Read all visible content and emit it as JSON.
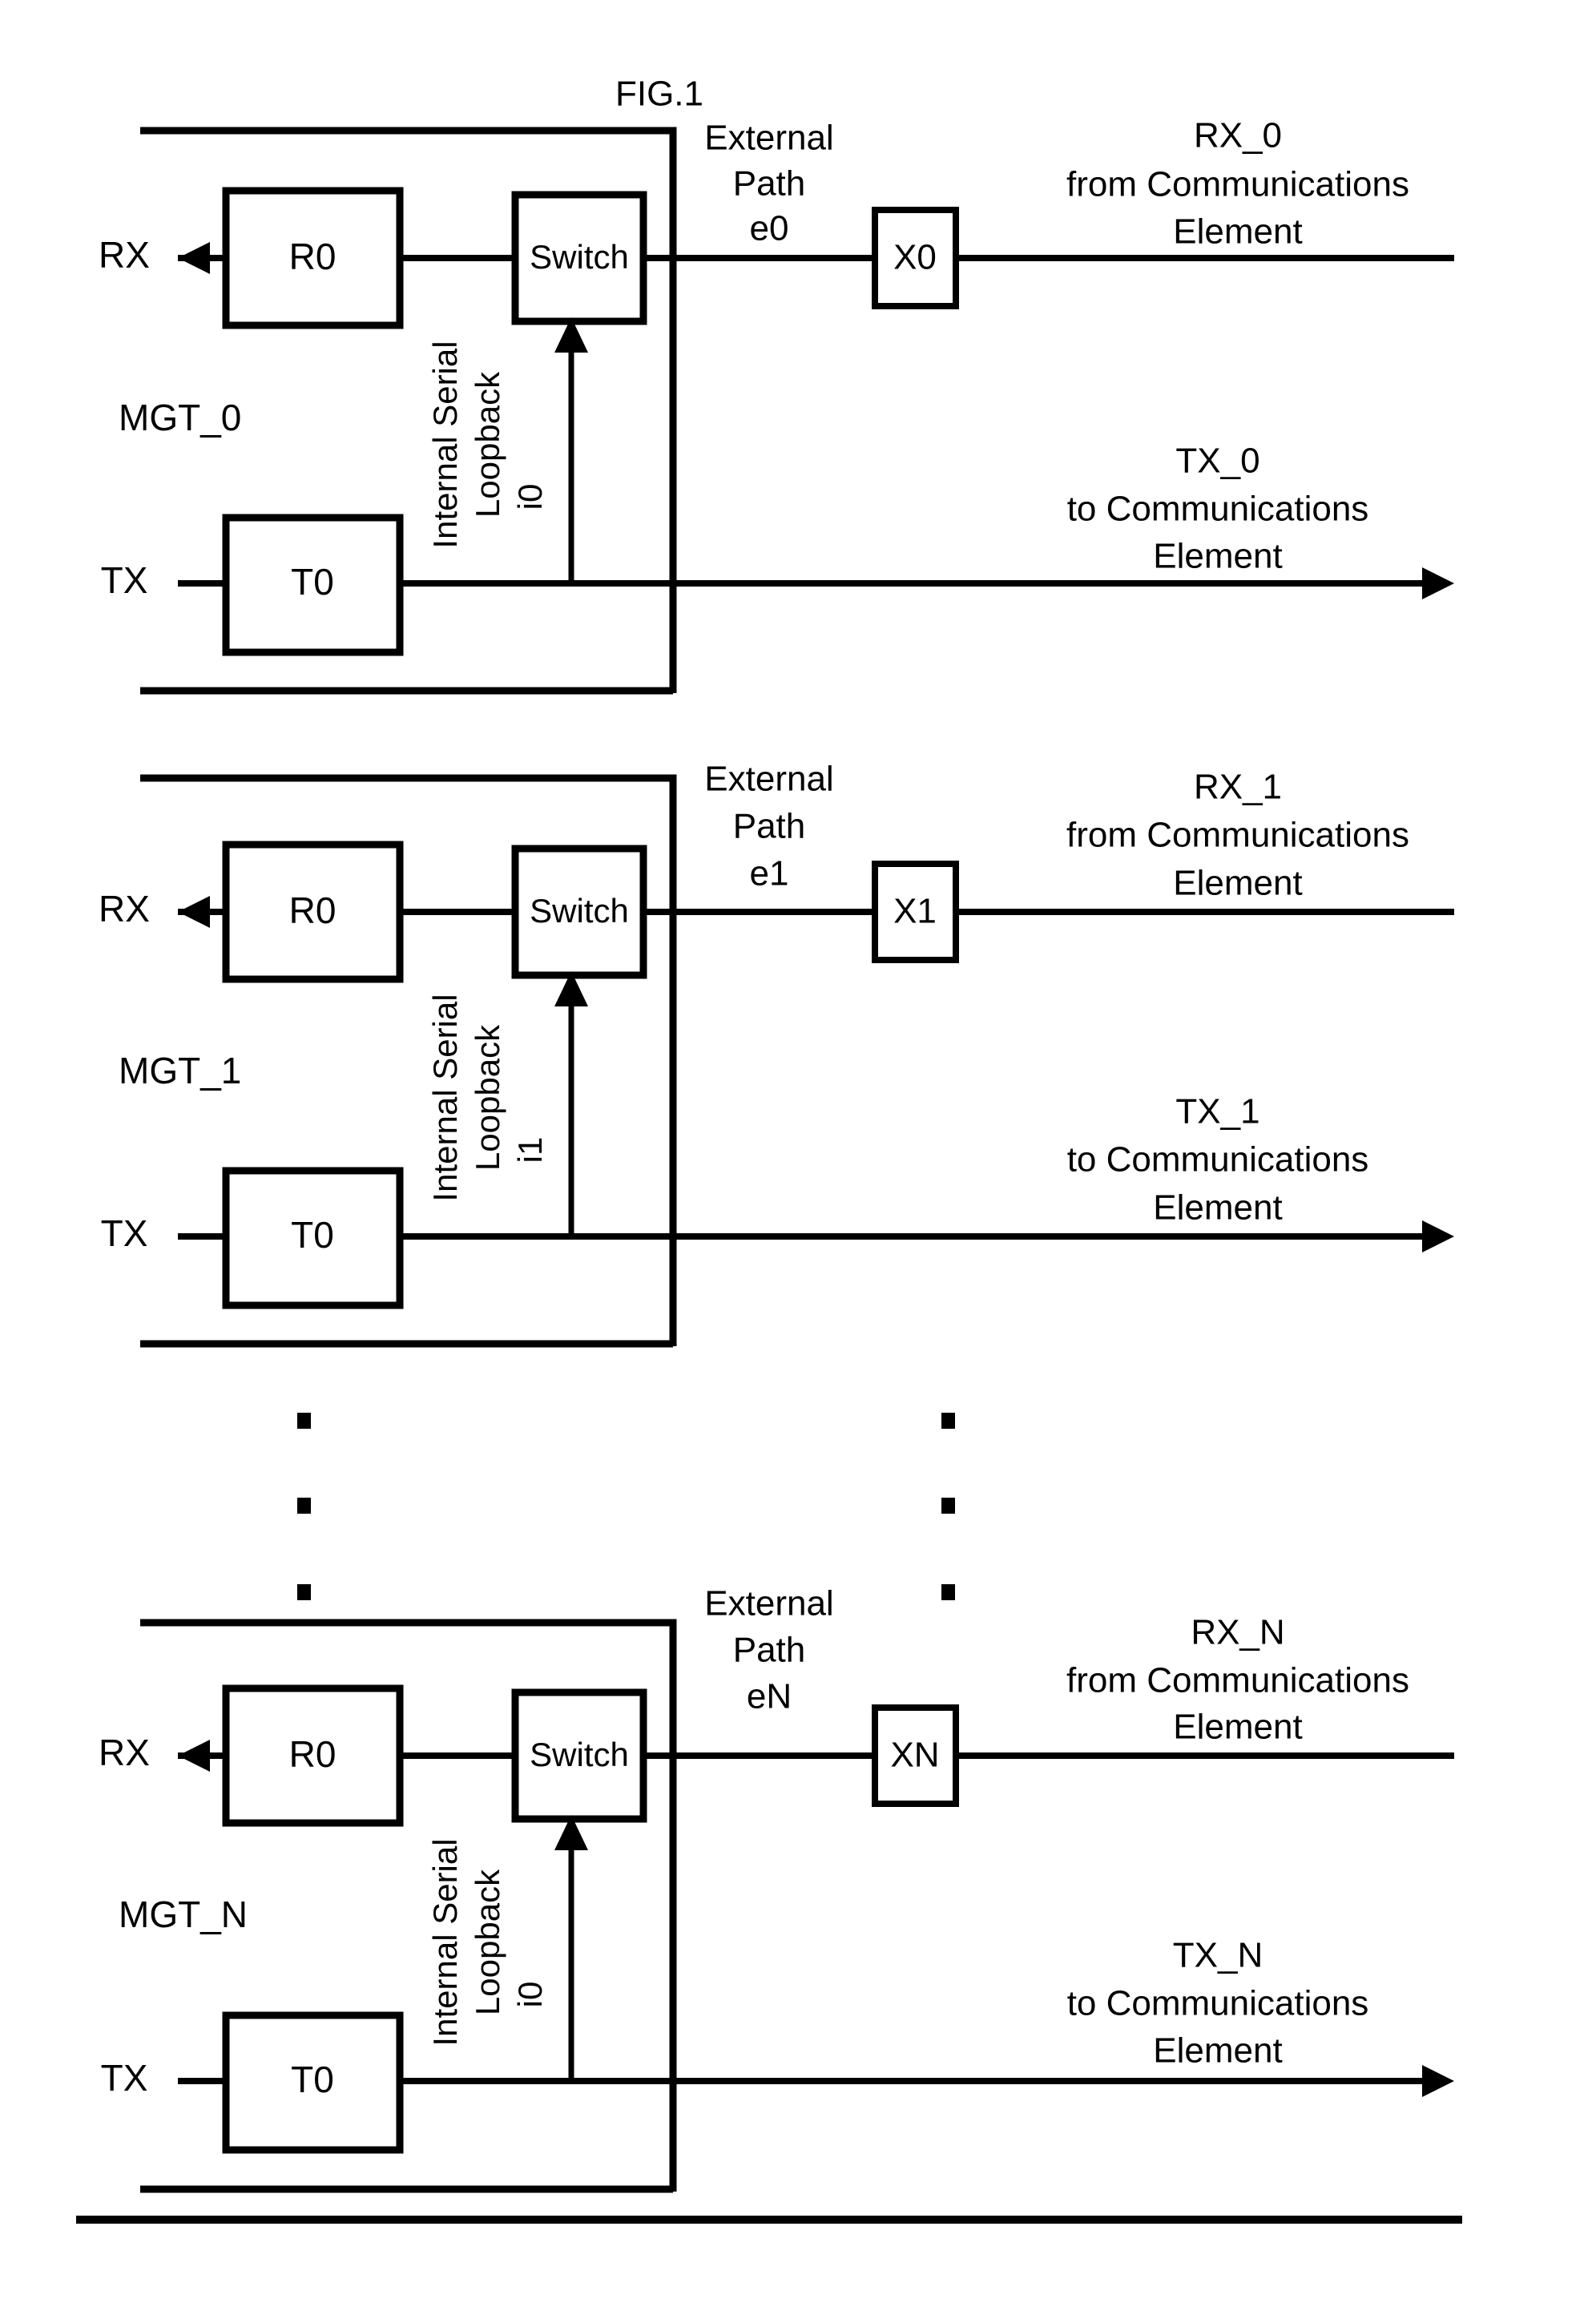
{
  "figure": {
    "label": "FIG.1",
    "background": "#ffffff",
    "ink": "#000000"
  },
  "blocks": [
    {
      "id": "mgt0",
      "mgt_label": "MGT_0",
      "rx_port_label": "RX",
      "tx_port_label": "TX",
      "receiver_box_label": "R0",
      "transmitter_box_label": "T0",
      "switch_box_label": "Switch",
      "loopback_line1": "Internal Serial",
      "loopback_line2": "Loopback",
      "loopback_id": "i0",
      "external_path_line1": "External",
      "external_path_line2": "Path",
      "external_path_id": "e0",
      "x_box_label": "X0",
      "rx_net_line1": "RX_0",
      "rx_net_line2": "from Communications",
      "rx_net_line3": "Element",
      "tx_net_line1": "TX_0",
      "tx_net_line2": "to Communications",
      "tx_net_line3": "Element"
    },
    {
      "id": "mgt1",
      "mgt_label": "MGT_1",
      "rx_port_label": "RX",
      "tx_port_label": "TX",
      "receiver_box_label": "R0",
      "transmitter_box_label": "T0",
      "switch_box_label": "Switch",
      "loopback_line1": "Internal Serial",
      "loopback_line2": "Loopback",
      "loopback_id": "i1",
      "external_path_line1": "External",
      "external_path_line2": "Path",
      "external_path_id": "e1",
      "x_box_label": "X1",
      "rx_net_line1": "RX_1",
      "rx_net_line2": "from Communications",
      "rx_net_line3": "Element",
      "tx_net_line1": "TX_1",
      "tx_net_line2": "to Communications",
      "tx_net_line3": "Element"
    },
    {
      "id": "mgtN",
      "mgt_label": "MGT_N",
      "rx_port_label": "RX",
      "tx_port_label": "TX",
      "receiver_box_label": "R0",
      "transmitter_box_label": "T0",
      "switch_box_label": "Switch",
      "loopback_line1": "Internal Serial",
      "loopback_line2": "Loopback",
      "loopback_id": "i0",
      "external_path_line1": "External",
      "external_path_line2": "Path",
      "external_path_id": "eN",
      "x_box_label": "XN",
      "rx_net_line1": "RX_N",
      "rx_net_line2": "from Communications",
      "rx_net_line3": "Element",
      "tx_net_line1": "TX_N",
      "tx_net_line2": "to Communications",
      "tx_net_line3": "Element"
    }
  ],
  "ellipsis": {
    "symbol": "vertical-dots",
    "count_per_column": 3,
    "columns": 2
  }
}
